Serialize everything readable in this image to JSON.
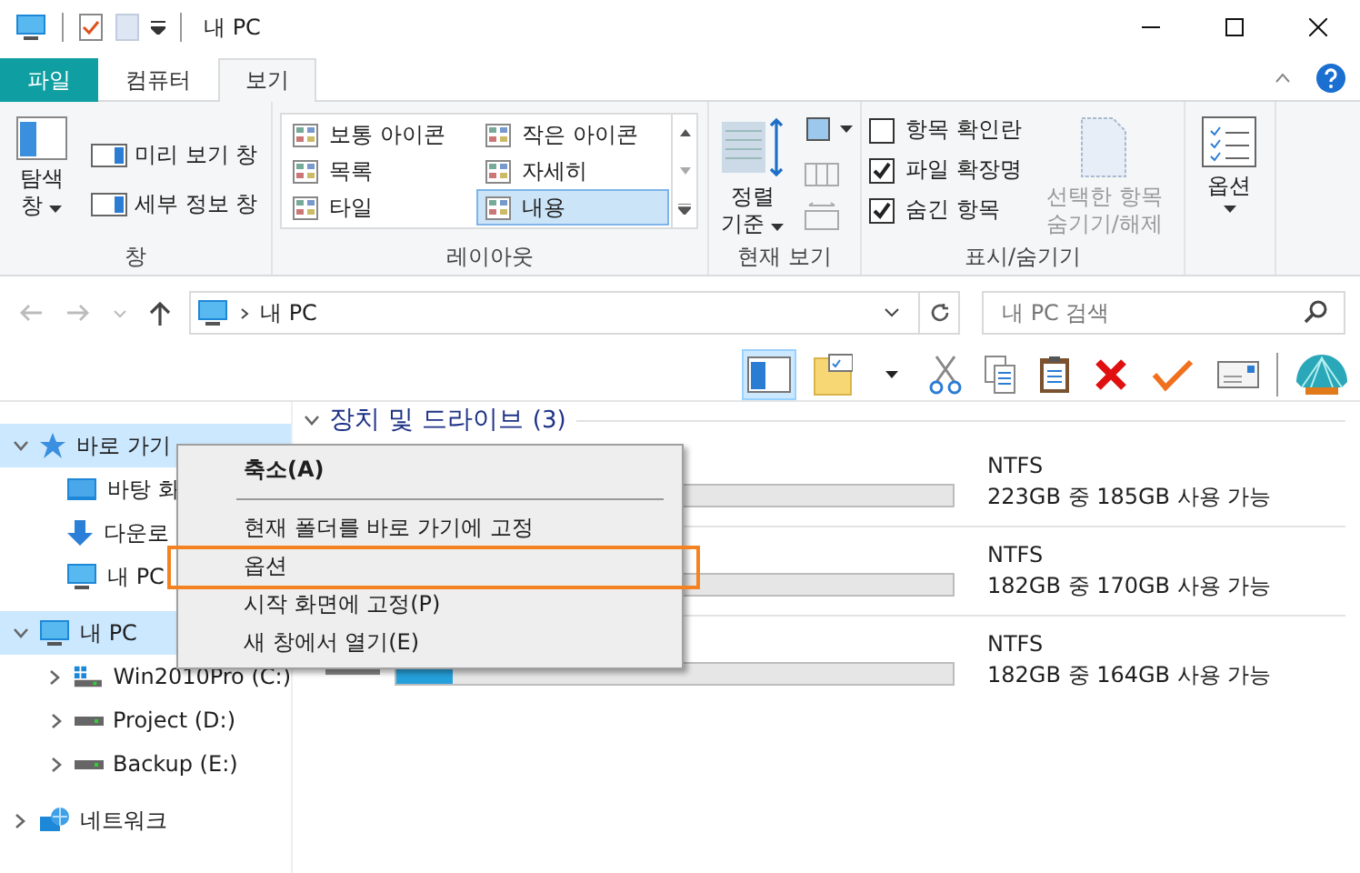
{
  "window": {
    "title": "내 PC"
  },
  "ribbon": {
    "tabs": [
      {
        "label": "파일",
        "kind": "file",
        "selected": false
      },
      {
        "label": "컴퓨터",
        "kind": "tab",
        "selected": false
      },
      {
        "label": "보기",
        "kind": "tab",
        "selected": true
      }
    ],
    "groups": [
      {
        "kind": "panes",
        "label": "창",
        "big": {
          "label": "탐색 창"
        },
        "items": [
          {
            "label": "미리 보기 창"
          },
          {
            "label": "세부 정보 창"
          }
        ]
      },
      {
        "kind": "layout",
        "label": "레이아웃",
        "items": [
          {
            "label": "보통 아이콘",
            "selected": false
          },
          {
            "label": "작은 아이콘",
            "selected": false
          },
          {
            "label": "목록",
            "selected": false
          },
          {
            "label": "자세히",
            "selected": false
          },
          {
            "label": "타일",
            "selected": false
          },
          {
            "label": "내용",
            "selected": true
          }
        ]
      },
      {
        "kind": "current_view",
        "label": "현재 보기",
        "big": {
          "label": "정렬 기준"
        }
      },
      {
        "kind": "show_hide",
        "label": "표시/숨기기",
        "checks": [
          {
            "label": "항목 확인란",
            "checked": false
          },
          {
            "label": "파일 확장명",
            "checked": true
          },
          {
            "label": "숨긴 항목",
            "checked": true
          }
        ],
        "big": {
          "label": "선택한 항목 숨기기/해제",
          "disabled": true
        }
      },
      {
        "kind": "options",
        "big": {
          "label": "옵션"
        }
      }
    ]
  },
  "address": {
    "path": "내 PC",
    "search_placeholder": "내 PC 검색"
  },
  "toolbar": {
    "pane_selected": true
  },
  "sidebar": {
    "items": [
      {
        "label": "바로 가기",
        "kind": "star",
        "expanded": true,
        "selected": true,
        "children": [
          {
            "label": "바탕 화",
            "kind": "desktop",
            "selected": false
          },
          {
            "label": "다운로",
            "kind": "download",
            "selected": false
          },
          {
            "label": "내 PC",
            "kind": "pc",
            "selected": false
          }
        ]
      },
      {
        "label": "내 PC",
        "kind": "pc",
        "expanded": true,
        "selected": true,
        "children": [
          {
            "label": "Win2010Pro (C:)",
            "kind": "windrive",
            "expanded": false,
            "selected": false
          },
          {
            "label": "Project (D:)",
            "kind": "drive",
            "expanded": false,
            "selected": false
          },
          {
            "label": "Backup (E:)",
            "kind": "drive",
            "expanded": false,
            "selected": false
          }
        ]
      },
      {
        "label": "네트워크",
        "kind": "network",
        "expanded": false,
        "selected": false
      }
    ]
  },
  "content": {
    "section": {
      "title": "장치 및 드라이브",
      "count": "(3)",
      "expanded": true
    },
    "drives": [
      {
        "filesystem": "NTFS",
        "space": "223GB 중 185GB 사용 가능"
      },
      {
        "filesystem": "NTFS",
        "space": "182GB 중 170GB 사용 가능"
      },
      {
        "filesystem": "NTFS",
        "space": "182GB 중 164GB 사용 가능",
        "level": 0.1
      }
    ]
  },
  "context_menu": {
    "items": [
      {
        "kind": "item",
        "label": "축소(A)",
        "default": true,
        "highlighted": false
      },
      {
        "kind": "separator"
      },
      {
        "kind": "item",
        "label": "현재 폴더를 바로 가기에 고정",
        "default": false,
        "highlighted": false
      },
      {
        "kind": "item",
        "label": "옵션",
        "default": false,
        "highlighted": true
      },
      {
        "kind": "item",
        "label": "시작 화면에 고정(P)",
        "default": false,
        "highlighted": false
      },
      {
        "kind": "item",
        "label": "새 창에서 열기(E)",
        "default": false,
        "highlighted": false
      }
    ]
  }
}
